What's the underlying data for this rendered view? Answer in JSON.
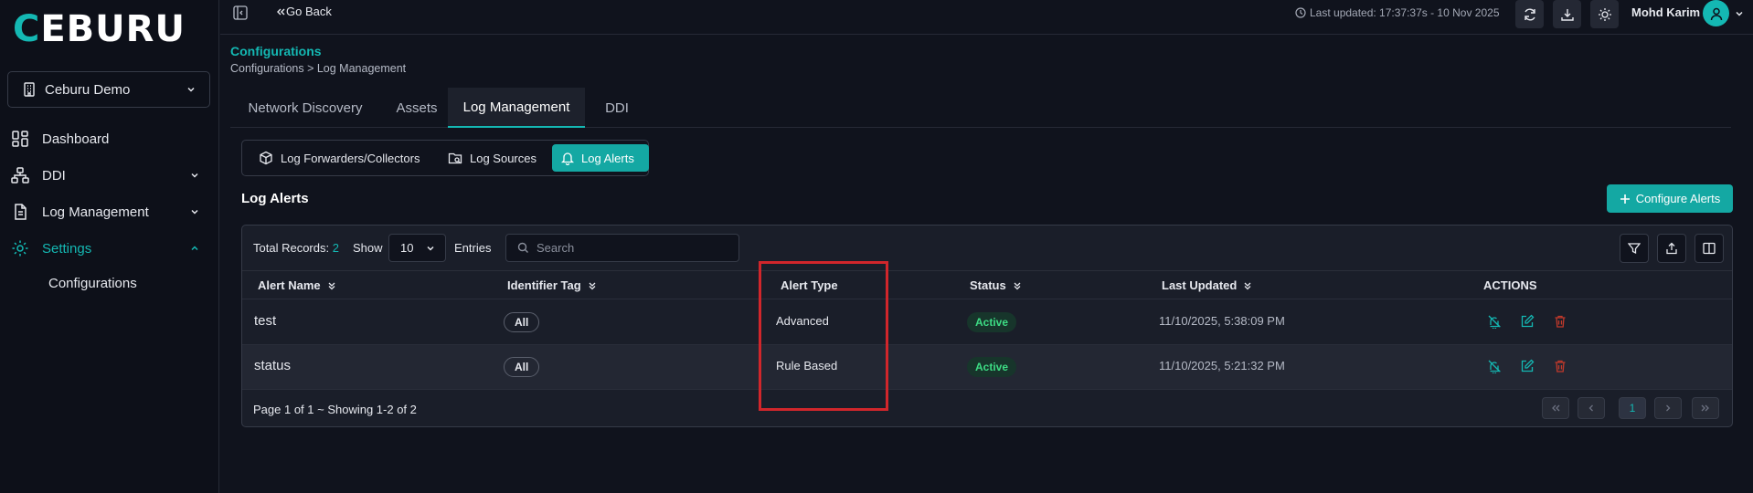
{
  "brand": {
    "logo_first": "C",
    "logo_rest": "EBURU",
    "accent": "#14b8b3"
  },
  "sidebar": {
    "org_name": "Ceburu Demo",
    "items": [
      {
        "label": "Dashboard",
        "icon": "dashboard-icon"
      },
      {
        "label": "DDI",
        "icon": "network-icon"
      },
      {
        "label": "Log Management",
        "icon": "document-icon"
      },
      {
        "label": "Settings",
        "icon": "gear-icon"
      }
    ],
    "sub_item": "Configurations"
  },
  "topbar": {
    "go_back": "Go Back",
    "last_updated": "Last updated: 17:37:37s - 10 Nov 2025",
    "user_name": "Mohd Karim"
  },
  "page": {
    "title": "Configurations",
    "breadcrumb": "Configurations > Log Management"
  },
  "tabs": [
    "Network Discovery",
    "Assets",
    "Log Management",
    "DDI"
  ],
  "subtabs": [
    "Log Forwarders/Collectors",
    "Log Sources",
    "Log Alerts"
  ],
  "section": {
    "title": "Log Alerts",
    "configure_button": "Configure Alerts"
  },
  "table": {
    "total_label": "Total Records:",
    "total_count": "2",
    "show_label": "Show",
    "page_size": "10",
    "entries_label": "Entries",
    "search_placeholder": "Search",
    "columns": [
      "Alert Name",
      "Identifier Tag",
      "Alert Type",
      "Status",
      "Last Updated",
      "ACTIONS"
    ],
    "rows": [
      {
        "name": "test",
        "tag": "All",
        "type": "Advanced",
        "status": "Active",
        "updated": "11/10/2025, 5:38:09 PM"
      },
      {
        "name": "status",
        "tag": "All",
        "type": "Rule Based",
        "status": "Active",
        "updated": "11/10/2025, 5:21:32 PM"
      }
    ],
    "footer": "Page 1 of 1 ~ Showing 1-2 of 2",
    "current_page": "1"
  },
  "colors": {
    "status_active": "#3ddc84",
    "delete": "#c0392b",
    "highlight": "#d1262b"
  }
}
